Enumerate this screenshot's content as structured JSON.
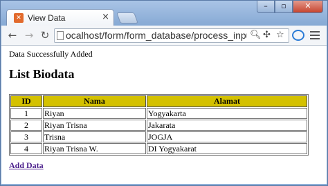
{
  "browser": {
    "tab_title": "View Data",
    "tab_favicon": "xampp-icon",
    "close_tab_glyph": "×",
    "window_controls": [
      "minimize-icon",
      "maximize-icon",
      "close-icon"
    ],
    "url": "ocalhost/form/form_database/process_input.php"
  },
  "page": {
    "status_message": "Data Successfully Added",
    "heading": "List Biodata",
    "table": {
      "columns": [
        "ID",
        "Nama",
        "Alamat"
      ],
      "rows": [
        {
          "id": "1",
          "nama": "Riyan",
          "alamat": "Yogyakarta"
        },
        {
          "id": "2",
          "nama": "Riyan Trisna",
          "alamat": "Jakarata"
        },
        {
          "id": "3",
          "nama": "Trisna",
          "alamat": "JOGJA"
        },
        {
          "id": "4",
          "nama": "Riyan Trisna W.",
          "alamat": "DI Yogyakarat"
        }
      ]
    },
    "add_link": "Add Data"
  },
  "colors": {
    "header_bg": "#d4c100",
    "link": "#4b1f8c"
  }
}
